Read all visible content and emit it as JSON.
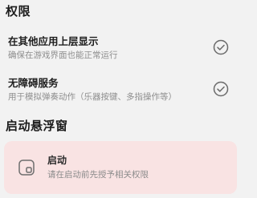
{
  "permissions": {
    "section_title": "权限",
    "items": [
      {
        "title": "在其他应用上层显示",
        "description": "确保在游戏界面也能正常运行",
        "status_icon": "check-circle-icon",
        "granted": true
      },
      {
        "title": "无障碍服务",
        "description": "用于模拟弹奏动作（乐器按键、多指操作等）",
        "status_icon": "check-circle-icon",
        "granted": true
      }
    ]
  },
  "floating_window": {
    "section_title": "启动悬浮窗",
    "card": {
      "icon": "floating-window-icon",
      "title": "启动",
      "description": "请在启动前先授予相关权限",
      "background_color": "#f9e3e3"
    }
  }
}
